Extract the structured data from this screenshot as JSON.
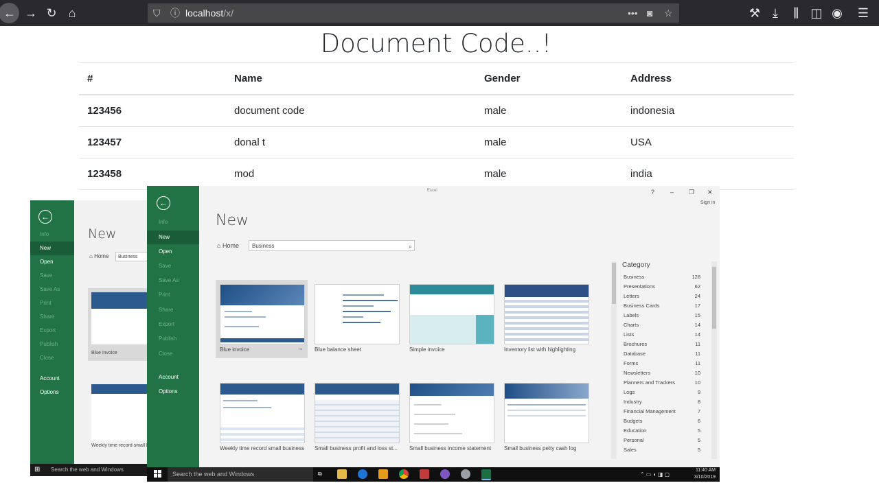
{
  "browser": {
    "url_host": "localhost",
    "url_path": "/x/"
  },
  "page": {
    "title": "Document Code..!",
    "table": {
      "headers": [
        "#",
        "Name",
        "Gender",
        "Address"
      ],
      "rows": [
        [
          "123456",
          "document code",
          "male",
          "indonesia"
        ],
        [
          "123457",
          "donal t",
          "male",
          "USA"
        ],
        [
          "123458",
          "mod",
          "male",
          "india"
        ]
      ]
    }
  },
  "excel_back": {
    "new_title": "New",
    "home_label": "Home",
    "search_value": "Business",
    "side_items": [
      "Info",
      "New",
      "Open",
      "Save",
      "Save As",
      "Print",
      "Share",
      "Export",
      "Publish",
      "Close",
      "Account",
      "Options"
    ],
    "templates": [
      "Blue invoice",
      "Weekly time record small bus"
    ]
  },
  "excel": {
    "window_title": "Excel",
    "sign_in": "Sign in",
    "help": "?",
    "minimize": "–",
    "restore": "❐",
    "close": "✕",
    "back_arrow": "←",
    "new_title": "New",
    "home_label": "Home",
    "search_value": "Business",
    "side_items": [
      "Info",
      "New",
      "Open",
      "Save",
      "Save As",
      "Print",
      "Share",
      "Export",
      "Publish",
      "Close",
      "Account",
      "Options"
    ],
    "templates": [
      "Blue invoice",
      "Blue balance sheet",
      "Simple invoice",
      "Inventory list with highlighting",
      "Weekly time record small business",
      "Small business profit and loss st...",
      "Small business income statement",
      "Small business petty cash log"
    ],
    "category_heading": "Category",
    "categories": [
      {
        "name": "Business",
        "count": "128"
      },
      {
        "name": "Presentations",
        "count": "62"
      },
      {
        "name": "Letters",
        "count": "24"
      },
      {
        "name": "Business Cards",
        "count": "17"
      },
      {
        "name": "Labels",
        "count": "15"
      },
      {
        "name": "Charts",
        "count": "14"
      },
      {
        "name": "Lists",
        "count": "14"
      },
      {
        "name": "Brochures",
        "count": "11"
      },
      {
        "name": "Database",
        "count": "11"
      },
      {
        "name": "Forms",
        "count": "11"
      },
      {
        "name": "Newsletters",
        "count": "10"
      },
      {
        "name": "Planners and Trackers",
        "count": "10"
      },
      {
        "name": "Logs",
        "count": "9"
      },
      {
        "name": "Industry",
        "count": "8"
      },
      {
        "name": "Financial Management",
        "count": "7"
      },
      {
        "name": "Budgets",
        "count": "6"
      },
      {
        "name": "Education",
        "count": "5"
      },
      {
        "name": "Personal",
        "count": "5"
      },
      {
        "name": "Sales",
        "count": "5"
      }
    ]
  },
  "taskbar": {
    "search_placeholder": "Search the web and Windows",
    "time": "11:40 AM",
    "date": "3/10/2019"
  }
}
